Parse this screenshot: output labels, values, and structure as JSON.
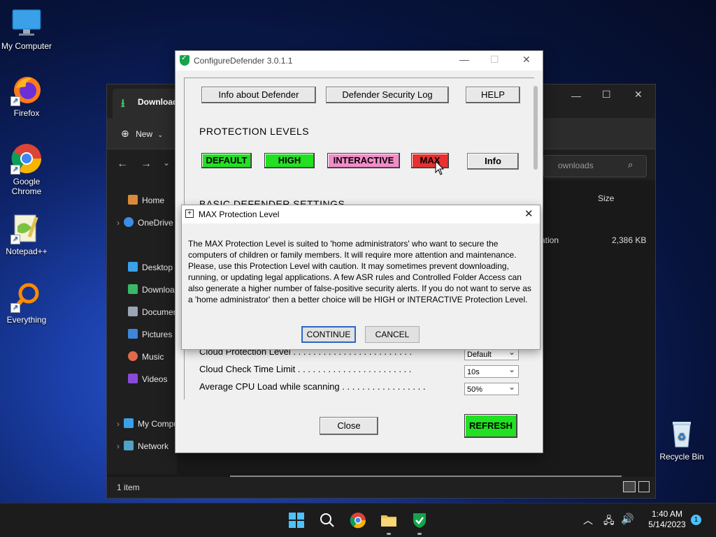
{
  "desktop": {
    "icons": [
      {
        "label": "My Computer",
        "icon": "monitor-icon"
      },
      {
        "label": "Firefox",
        "icon": "firefox-icon"
      },
      {
        "label": "Google Chrome",
        "icon": "chrome-icon"
      },
      {
        "label": "Notepad++",
        "icon": "notepad-icon"
      },
      {
        "label": "Everything",
        "icon": "search-magnifier-icon"
      },
      {
        "label": "Recycle Bin",
        "icon": "recycle-bin-icon"
      }
    ]
  },
  "explorer": {
    "tab_title": "Download",
    "new_label": "New",
    "search_placeholder": "ownloads",
    "column_size": "Size",
    "file_partial_name": "ation",
    "file_size": "2,386 KB",
    "status_text": "1 item",
    "sidebar": [
      "Home",
      "OneDrive",
      "Desktop",
      "Downloads",
      "Documents",
      "Pictures",
      "Music",
      "Videos",
      "My Computer",
      "Network"
    ]
  },
  "defender": {
    "title": "ConfigureDefender 3.0.1.1",
    "info_button": "Info about Defender",
    "log_button": "Defender Security Log",
    "help_button": "HELP",
    "protection_heading": "PROTECTION LEVELS",
    "levels": {
      "default": "DEFAULT",
      "high": "HIGH",
      "interactive": "INTERACTIVE",
      "max": "MAX",
      "info": "Info"
    },
    "basic_heading": "BASIC DEFENDER SETTINGS",
    "settings": [
      {
        "label": "Cloud Protection Level . . . . . . . . . . . . . . . . . . . . . . . .",
        "value": "Default"
      },
      {
        "label": "Cloud Check Time Limit . . . . . . . . . . . . . . . . . . . . . . .",
        "value": "10s"
      },
      {
        "label": "Average CPU Load while scanning . . . . . . . . . . . . . . . . .",
        "value": "50%"
      }
    ],
    "close_button": "Close",
    "refresh_button": "REFRESH"
  },
  "dialog": {
    "title": "MAX Protection Level",
    "body": "The MAX Protection Level is suited to 'home administrators' who want to secure the computers of children or family members. It will require more attention and maintenance. Please, use this Protection Level with caution. It may sometimes prevent downloading, running, or updating legal applications. A few ASR rules and Controlled Folder Access can also generate a higher number of false-positive security alerts. If you do not want to serve as a 'home administrator' then a better choice will be HIGH or INTERACTIVE Protection Level.",
    "continue_button": "CONTINUE",
    "cancel_button": "CANCEL"
  },
  "taskbar": {
    "time": "1:40 AM",
    "date": "5/14/2023",
    "notification_count": "1"
  },
  "colors": {
    "level_default": "#22e022",
    "level_high": "#22e022",
    "level_interactive": "#f28cc8",
    "level_max": "#e83030",
    "refresh": "#22e022"
  }
}
